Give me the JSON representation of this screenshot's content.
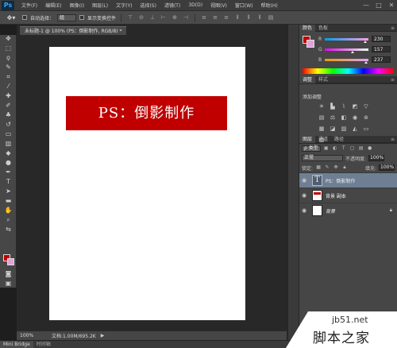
{
  "app": {
    "logo": "Ps"
  },
  "menu": [
    "文件(F)",
    "编辑(E)",
    "图像(I)",
    "图层(L)",
    "文字(Y)",
    "选择(S)",
    "滤镜(T)",
    "3D(D)",
    "视图(V)",
    "窗口(W)",
    "帮助(H)"
  ],
  "window_controls": [
    "—",
    "□",
    "✕"
  ],
  "options_bar": {
    "auto_select_label": "自动选择：",
    "auto_select_value": "组",
    "show_transform_label": "显示变换控件"
  },
  "document": {
    "tab_title": "未标题-1 @ 100% (PS：倒影制作, RGB/8) *",
    "canvas_text": "PS：倒影制作"
  },
  "colors": {
    "foreground": "#c00000",
    "background": "#e3a2d7"
  },
  "status": {
    "zoom": "100%",
    "doc_info": "文档:1.00M/695.2K"
  },
  "bottom_tabs": [
    "Mini Bridge",
    "时间轴"
  ],
  "panels": {
    "color_tabs": [
      "颜色",
      "色板"
    ],
    "sliders": [
      {
        "label": "R",
        "value": "230"
      },
      {
        "label": "G",
        "value": "157"
      },
      {
        "label": "B",
        "value": "237"
      }
    ],
    "adjust_tabs": [
      "调整",
      "样式"
    ],
    "adjust_title": "添加调整",
    "layers_tabs": [
      "图层",
      "通道",
      "路径"
    ],
    "filter_label": "ρ 类型",
    "blend_mode": "正常",
    "opacity_label": "不透明度:",
    "opacity_value": "100%",
    "lock_label": "锁定:",
    "fill_label": "填充:",
    "fill_value": "100%",
    "layers": [
      {
        "name": "PS：倒影制作"
      },
      {
        "name": "背景 副本"
      },
      {
        "name": "背景"
      }
    ]
  },
  "watermark": {
    "url": "jb51.net",
    "cn": "脚本之家"
  }
}
